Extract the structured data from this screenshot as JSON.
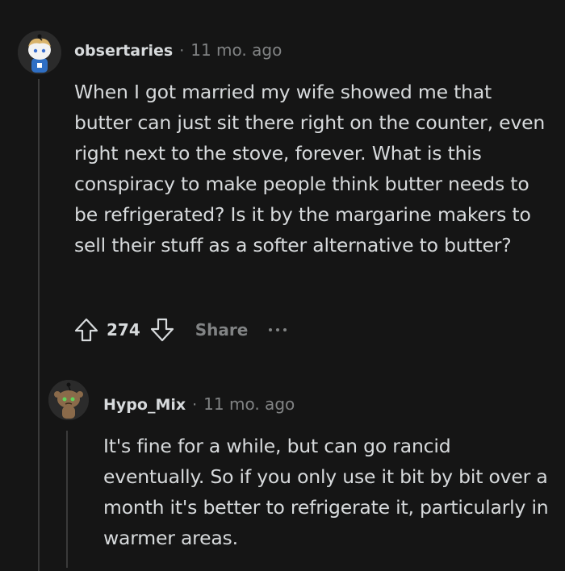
{
  "comments": [
    {
      "author": "obsertaries",
      "separator": "·",
      "time": "11 mo. ago",
      "avatar_icon": "snoo-avatar-icon",
      "body": "When I got married my wife showed me that butter can just sit there right on the counter, even right next to the stove, forever. What is this conspiracy to make people think butter needs to be refrigerated? Is it by the margarine makers to sell their stuff as a softer alternative to butter?",
      "votes": "274",
      "share_label": "Share"
    },
    {
      "author": "Hypo_Mix",
      "separator": "·",
      "time": "11 mo. ago",
      "avatar_icon": "snoo-avatar-icon",
      "body": "It's fine for a while, but can go rancid eventually. So if you only use it bit by bit over a month it's better to refrigerate it, particularly in warmer areas."
    }
  ],
  "colors": {
    "background": "#151515",
    "text": "#d7dadc",
    "muted": "#818384",
    "thread_line": "#3a3a3a"
  }
}
